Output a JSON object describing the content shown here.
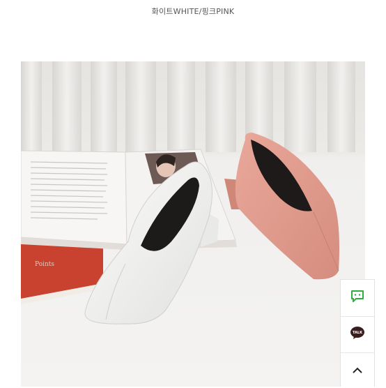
{
  "caption": "화이트WHITE/핑크PINK",
  "photo": {
    "alt": "white and pink square-toe heels on a book",
    "book_text": "Points"
  },
  "side_buttons": {
    "talk_text": "TALK",
    "icons": [
      "chat-dots-icon",
      "kakaotalk-icon",
      "chevron-up-icon"
    ],
    "accent_green": "#2fae3e"
  }
}
